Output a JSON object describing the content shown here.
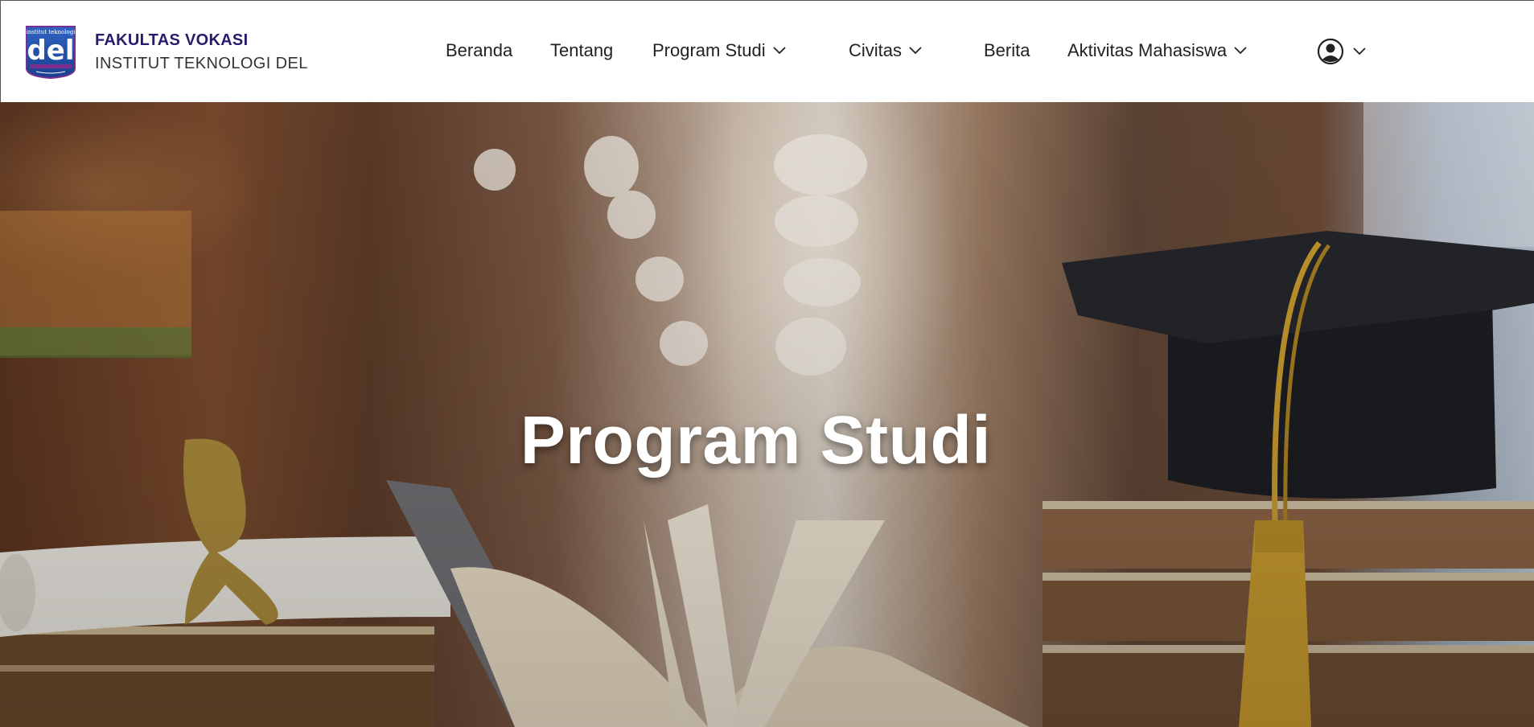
{
  "brand": {
    "line1": "FAKULTAS VOKASI",
    "line2": "INSTITUT TEKNOLOGI DEL",
    "logo_top_text": "institut teknologi",
    "logo_word": "del"
  },
  "nav": {
    "beranda": "Beranda",
    "tentang": "Tentang",
    "program_studi": "Program Studi",
    "civitas": "Civitas",
    "berita": "Berita",
    "aktivitas": "Aktivitas Mahasiswa"
  },
  "icons": {
    "user": "user-circle-icon",
    "chevron": "chevron-down-icon"
  },
  "hero": {
    "title": "Program Studi"
  },
  "colors": {
    "brand_primary": "#2a1a6e",
    "logo_blue": "#1f4fa8",
    "nav_text": "#222222"
  }
}
